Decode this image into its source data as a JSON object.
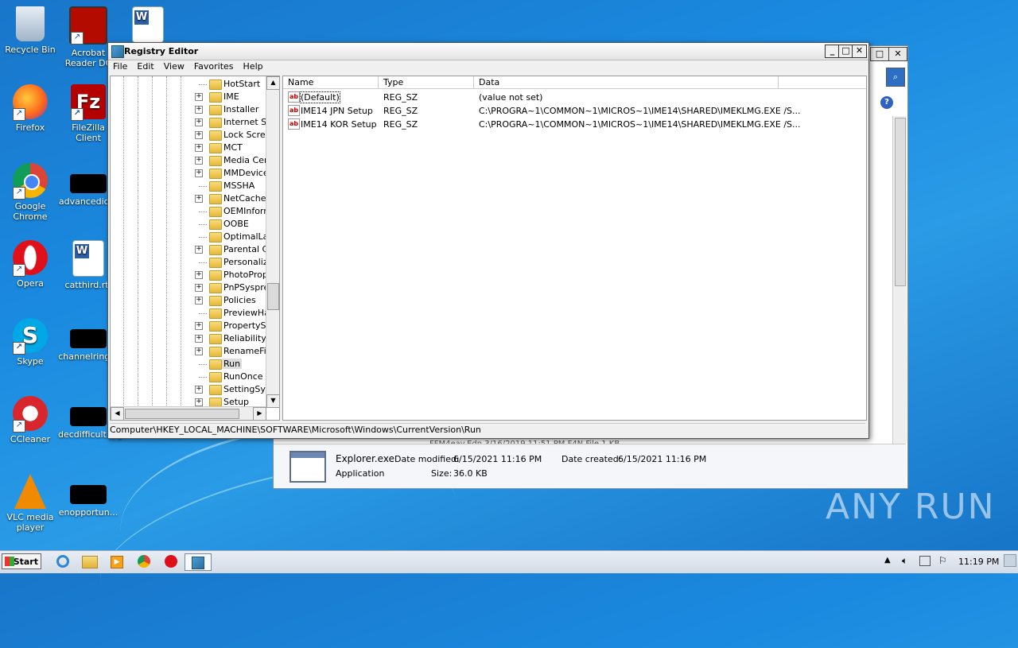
{
  "desktop": {
    "icons": [
      {
        "label": "Recycle Bin"
      },
      {
        "label": "Acrobat Reader DC"
      },
      {
        "label": "Firefox"
      },
      {
        "label": "FileZilla Client"
      },
      {
        "label": "Google Chrome"
      },
      {
        "label": "advancedid..."
      },
      {
        "label": "Opera"
      },
      {
        "label": "catthird.rtf"
      },
      {
        "label": "Skype"
      },
      {
        "label": "channelring..."
      },
      {
        "label": "CCleaner"
      },
      {
        "label": "decdifficult.jpg"
      },
      {
        "label": "VLC media player"
      },
      {
        "label": "enopportun..."
      }
    ],
    "watermark": "ANY RUN"
  },
  "explorer_window": {
    "partial_row": "FFM4eav.Edn   3/16/2019 11:51 PM   F4N File   1 KB",
    "details": {
      "name": "Explorer.exe",
      "type": "Application",
      "date_modified_label": "Date modified:",
      "date_modified": "6/15/2021 11:16 PM",
      "date_created_label": "Date created:",
      "date_created": "6/15/2021 11:16 PM",
      "size_label": "Size:",
      "size": "36.0 KB"
    }
  },
  "registry": {
    "title": "Registry Editor",
    "menu": [
      "File",
      "Edit",
      "View",
      "Favorites",
      "Help"
    ],
    "tree": [
      {
        "label": "HotStart",
        "expandable": false
      },
      {
        "label": "IME",
        "expandable": true
      },
      {
        "label": "Installer",
        "expandable": true
      },
      {
        "label": "Internet Se",
        "expandable": true
      },
      {
        "label": "Lock Screen",
        "expandable": true
      },
      {
        "label": "MCT",
        "expandable": true
      },
      {
        "label": "Media Cent",
        "expandable": true
      },
      {
        "label": "MMDevices",
        "expandable": true
      },
      {
        "label": "MSSHA",
        "expandable": false
      },
      {
        "label": "NetCache",
        "expandable": true
      },
      {
        "label": "OEMInform",
        "expandable": false
      },
      {
        "label": "OOBE",
        "expandable": false
      },
      {
        "label": "OptimalLay",
        "expandable": false
      },
      {
        "label": "Parental Co",
        "expandable": true
      },
      {
        "label": "Personalize",
        "expandable": false
      },
      {
        "label": "PhotoPrope",
        "expandable": true
      },
      {
        "label": "PnPSysprep",
        "expandable": true
      },
      {
        "label": "Policies",
        "expandable": true
      },
      {
        "label": "PreviewHar",
        "expandable": false
      },
      {
        "label": "PropertySy",
        "expandable": true
      },
      {
        "label": "Reliability",
        "expandable": true
      },
      {
        "label": "RenameFile",
        "expandable": true
      },
      {
        "label": "Run",
        "expandable": false,
        "selected": true
      },
      {
        "label": "RunOnce",
        "expandable": false
      },
      {
        "label": "SettingSyn",
        "expandable": true
      },
      {
        "label": "Setup",
        "expandable": true
      }
    ],
    "columns": [
      "Name",
      "Type",
      "Data"
    ],
    "values": [
      {
        "name": "(Default)",
        "type": "REG_SZ",
        "data": "(value not set)"
      },
      {
        "name": "IME14 JPN Setup",
        "type": "REG_SZ",
        "data": "C:\\PROGRA~1\\COMMON~1\\MICROS~1\\IME14\\SHARED\\IMEKLMG.EXE /S..."
      },
      {
        "name": "IME14 KOR Setup",
        "type": "REG_SZ",
        "data": "C:\\PROGRA~1\\COMMON~1\\MICROS~1\\IME14\\SHARED\\IMEKLMG.EXE /S..."
      }
    ],
    "status_path": "Computer\\HKEY_LOCAL_MACHINE\\SOFTWARE\\Microsoft\\Windows\\CurrentVersion\\Run"
  },
  "taskbar": {
    "start_label": "Start",
    "clock": "11:19 PM"
  }
}
